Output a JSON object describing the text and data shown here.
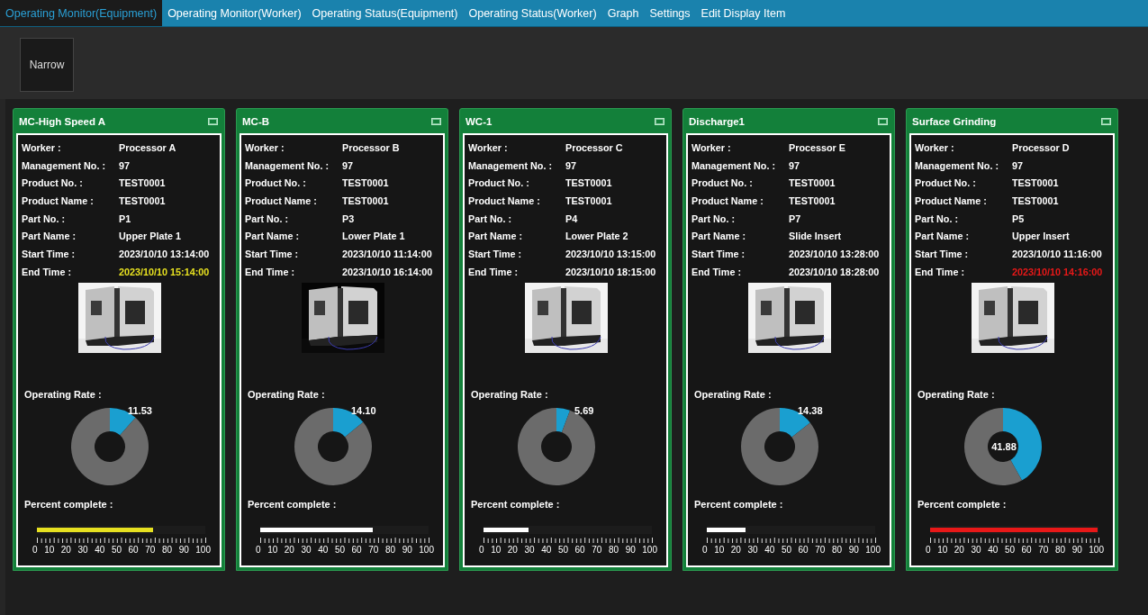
{
  "tabs": [
    {
      "label": "Operating Monitor(Equipment)",
      "selected": true
    },
    {
      "label": "Operating Monitor(Worker)",
      "selected": false
    },
    {
      "label": "Operating Status(Equipment)",
      "selected": false
    },
    {
      "label": "Operating Status(Worker)",
      "selected": false
    },
    {
      "label": "Graph",
      "selected": false
    },
    {
      "label": "Settings",
      "selected": false
    },
    {
      "label": "Edit Display Item",
      "selected": false
    }
  ],
  "narrow_button": "Narrow",
  "cards": [
    {
      "title": "MC-High Speed A",
      "color": "#e6e020",
      "fields": [
        {
          "label": "Worker :",
          "value": "Processor A"
        },
        {
          "label": "Management No. :",
          "value": "97"
        },
        {
          "label": "Product No. :",
          "value": "TEST0001"
        },
        {
          "label": "Product Name :",
          "value": "TEST0001"
        },
        {
          "label": "Part No. :",
          "value": "P1"
        },
        {
          "label": "Part Name :",
          "value": "Upper Plate 1"
        },
        {
          "label": "Start Time :",
          "value": "2023/10/10 13:14:00"
        },
        {
          "label": "End Time :",
          "value": "2023/10/10 15:14:00",
          "kind": "deadline"
        }
      ],
      "rate_label": "Operating Rate :",
      "operating_rate": {
        "chart_data": {
          "type": "donut",
          "values": [
            11.53,
            88.47
          ],
          "value_labels": [
            "11.53",
            null
          ]
        }
      },
      "progress_label": "Percent complete :",
      "progress": {
        "level": 0.69
      },
      "scale": [
        "0",
        "10",
        "20",
        "30",
        "40",
        "50",
        "60",
        "70",
        "80",
        "90",
        "100"
      ]
    },
    {
      "title": "MC-B",
      "color": "#ffffff",
      "fields": [
        {
          "label": "Worker :",
          "value": "Processor B"
        },
        {
          "label": "Management No. :",
          "value": "97"
        },
        {
          "label": "Product No. :",
          "value": "TEST0001"
        },
        {
          "label": "Product Name :",
          "value": "TEST0001"
        },
        {
          "label": "Part No. :",
          "value": "P3"
        },
        {
          "label": "Part Name :",
          "value": "Lower Plate 1"
        },
        {
          "label": "Start Time :",
          "value": "2023/10/10 11:14:00"
        },
        {
          "label": "End Time :",
          "value": "2023/10/10 16:14:00",
          "kind": "deadline"
        }
      ],
      "rate_label": "Operating Rate :",
      "operating_rate": {
        "chart_data": {
          "type": "donut",
          "values": [
            14.1,
            85.9
          ],
          "value_labels": [
            "14.10",
            null
          ]
        }
      },
      "progress_label": "Percent complete :",
      "progress": {
        "level": 0.67
      },
      "scale": [
        "0",
        "10",
        "20",
        "30",
        "40",
        "50",
        "60",
        "70",
        "80",
        "90",
        "100"
      ]
    },
    {
      "title": "WC-1",
      "color": "#ffffff",
      "fields": [
        {
          "label": "Worker :",
          "value": "Processor C"
        },
        {
          "label": "Management No. :",
          "value": "97"
        },
        {
          "label": "Product No. :",
          "value": "TEST0001"
        },
        {
          "label": "Product Name :",
          "value": "TEST0001"
        },
        {
          "label": "Part No. :",
          "value": "P4"
        },
        {
          "label": "Part Name :",
          "value": "Lower Plate 2"
        },
        {
          "label": "Start Time :",
          "value": "2023/10/10 13:15:00"
        },
        {
          "label": "End Time :",
          "value": "2023/10/10 18:15:00",
          "kind": "deadline"
        }
      ],
      "rate_label": "Operating Rate :",
      "operating_rate": {
        "chart_data": {
          "type": "donut",
          "values": [
            5.69,
            94.31
          ],
          "value_labels": [
            "5.69",
            null
          ]
        }
      },
      "progress_label": "Percent complete :",
      "progress": {
        "level": 0.27
      },
      "scale": [
        "0",
        "10",
        "20",
        "30",
        "40",
        "50",
        "60",
        "70",
        "80",
        "90",
        "100"
      ]
    },
    {
      "title": "Discharge1",
      "color": "#ffffff",
      "fields": [
        {
          "label": "Worker :",
          "value": "Processor E"
        },
        {
          "label": "Management No. :",
          "value": "97"
        },
        {
          "label": "Product No. :",
          "value": "TEST0001"
        },
        {
          "label": "Product Name :",
          "value": "TEST0001"
        },
        {
          "label": "Part No. :",
          "value": "P7"
        },
        {
          "label": "Part Name :",
          "value": "Slide Insert"
        },
        {
          "label": "Start Time :",
          "value": "2023/10/10 13:28:00"
        },
        {
          "label": "End Time :",
          "value": "2023/10/10 18:28:00",
          "kind": "deadline"
        }
      ],
      "rate_label": "Operating Rate :",
      "operating_rate": {
        "chart_data": {
          "type": "donut",
          "values": [
            14.38,
            85.62
          ],
          "value_labels": [
            "14.38",
            null
          ]
        }
      },
      "progress_label": "Percent complete :",
      "progress": {
        "level": 0.23
      },
      "scale": [
        "0",
        "10",
        "20",
        "30",
        "40",
        "50",
        "60",
        "70",
        "80",
        "90",
        "100"
      ]
    },
    {
      "title": "Surface Grinding",
      "color": "#e81818",
      "fields": [
        {
          "label": "Worker :",
          "value": "Processor D"
        },
        {
          "label": "Management No. :",
          "value": "97"
        },
        {
          "label": "Product No. :",
          "value": "TEST0001"
        },
        {
          "label": "Product Name :",
          "value": "TEST0001"
        },
        {
          "label": "Part No. :",
          "value": "P5"
        },
        {
          "label": "Part Name :",
          "value": "Upper Insert"
        },
        {
          "label": "Start Time :",
          "value": "2023/10/10 11:16:00"
        },
        {
          "label": "End Time :",
          "value": "2023/10/10 14:16:00",
          "kind": "deadline"
        }
      ],
      "rate_label": "Operating Rate :",
      "operating_rate": {
        "chart_data": {
          "type": "donut",
          "values": [
            41.88,
            58.12
          ],
          "value_labels": [
            "41.88",
            null
          ]
        }
      },
      "progress_label": "Percent complete :",
      "progress": {
        "level": 0.995
      },
      "scale": [
        "0",
        "10",
        "20",
        "30",
        "40",
        "50",
        "60",
        "70",
        "80",
        "90",
        "100"
      ]
    }
  ]
}
